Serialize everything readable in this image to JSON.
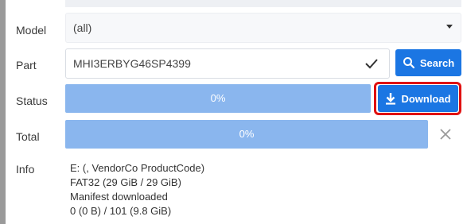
{
  "form": {
    "model": {
      "label": "Model",
      "value": "(all)"
    },
    "part": {
      "label": "Part",
      "value": "MHI3ERBYG46SP4399",
      "search_label": "Search"
    },
    "status": {
      "label": "Status",
      "progress_text": "0%",
      "progress_fraction": 0,
      "download_label": "Download"
    },
    "total": {
      "label": "Total",
      "progress_text": "0%",
      "progress_fraction": 0
    },
    "info": {
      "label": "Info",
      "lines": [
        "E: (, VendorCo ProductCode)",
        "FAT32 (29 GiB / 29 GiB)",
        "Manifest downloaded",
        "0 (0 B) / 101 (9.8 GiB)"
      ]
    }
  },
  "icons": {
    "model_dropdown": "caret-down-icon",
    "part_valid": "check-icon",
    "search": "search-icon",
    "download": "download-icon",
    "cancel": "close-icon"
  },
  "colors": {
    "primary": "#1b76e3",
    "progress": "#8ab6ee",
    "highlight": "#e01010"
  }
}
